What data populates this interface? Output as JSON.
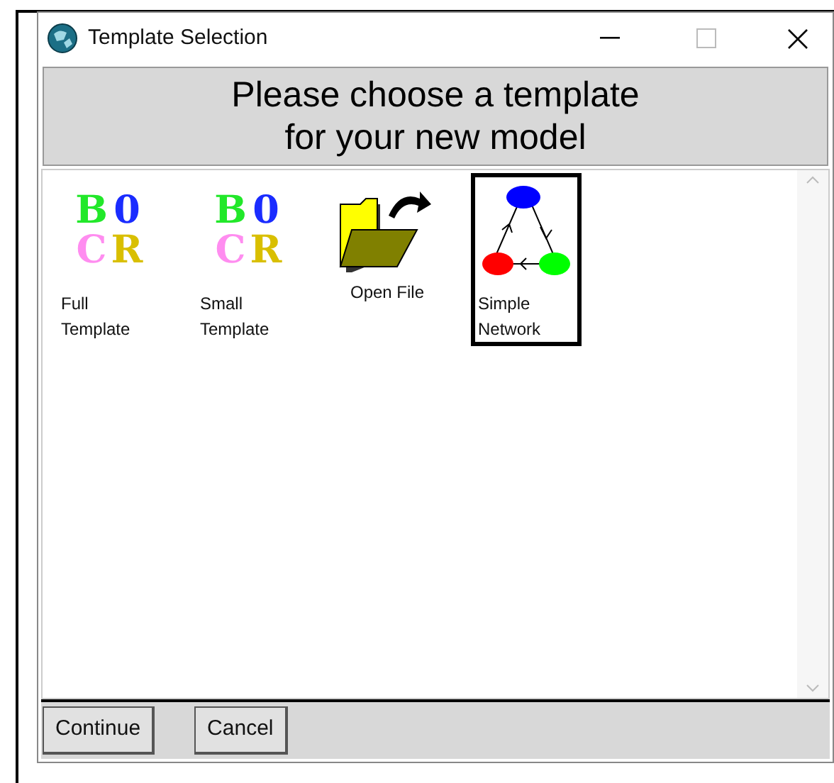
{
  "window": {
    "title": "Template Selection"
  },
  "header": [
    "Please choose a template",
    "for your new model"
  ],
  "templates": [
    {
      "kind": "logo",
      "logo": [
        "B",
        "0",
        "C",
        "R"
      ],
      "label": [
        "Full",
        "Template"
      ],
      "selected": false
    },
    {
      "kind": "logo",
      "logo": [
        "B",
        "0",
        "C",
        "R"
      ],
      "label": [
        "Small",
        "Template"
      ],
      "selected": false
    },
    {
      "kind": "folder",
      "label": [
        "Open File"
      ],
      "selected": false
    },
    {
      "kind": "network",
      "label": [
        "Simple",
        "Network"
      ],
      "selected": true
    }
  ],
  "buttons": [
    "Continue",
    "Cancel"
  ]
}
